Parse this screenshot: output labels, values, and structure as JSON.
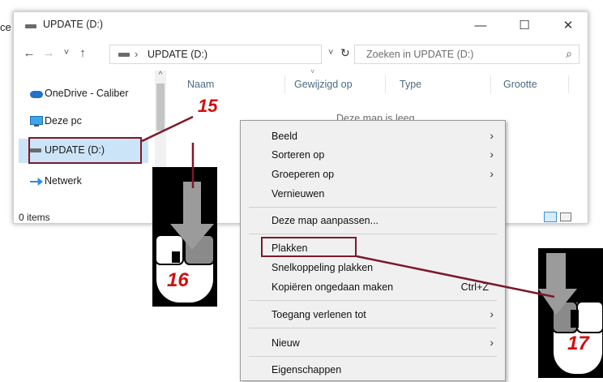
{
  "page_fragment": "ce",
  "window": {
    "title": "UPDATE (D:)",
    "min_glyph": "—",
    "max_glyph": "☐",
    "close_glyph": "✕"
  },
  "address": {
    "back_glyph": "←",
    "forward_glyph": "→",
    "recent_glyph": "˅",
    "up_glyph": "↑",
    "separator": "›",
    "path": "UPDATE (D:)",
    "dropdown_glyph": "˅",
    "refresh_glyph": "↻",
    "search_placeholder": "Zoeken in UPDATE (D:)",
    "search_glyph": "⌕"
  },
  "nav": {
    "items": [
      {
        "label": "OneDrive - Caliber"
      },
      {
        "label": "Deze pc"
      },
      {
        "label": "UPDATE (D:)"
      },
      {
        "label": "Netwerk"
      }
    ],
    "scroll_up_glyph": "^"
  },
  "status": {
    "items_text": "0 items"
  },
  "columns": [
    "Naam",
    "Gewijzigd op",
    "Type",
    "Grootte"
  ],
  "sort_glyph": "˅",
  "empty_text": "Deze map is leeg.",
  "context_menu": {
    "groups": [
      [
        {
          "label": "Beeld",
          "submenu": true
        },
        {
          "label": "Sorteren op",
          "submenu": true
        },
        {
          "label": "Groeperen op",
          "submenu": true
        },
        {
          "label": "Vernieuwen",
          "submenu": false
        }
      ],
      [
        {
          "label": "Deze map aanpassen...",
          "submenu": false
        }
      ],
      [
        {
          "label": "Plakken",
          "submenu": false
        },
        {
          "label": "Snelkoppeling plakken",
          "submenu": false
        },
        {
          "label": "Kopiëren ongedaan maken",
          "submenu": false,
          "shortcut": "Ctrl+Z"
        }
      ],
      [
        {
          "label": "Toegang verlenen tot",
          "submenu": true
        }
      ],
      [
        {
          "label": "Nieuw",
          "submenu": true
        }
      ],
      [
        {
          "label": "Eigenschappen",
          "submenu": false
        }
      ]
    ],
    "submenu_glyph": "›"
  },
  "annotations": {
    "step_15": "15",
    "step_16": "16",
    "step_17": "17"
  },
  "colors": {
    "callout_red": "#d01010",
    "highlight_border": "#7b1a2a",
    "selection_bg": "#cce4f7",
    "menu_bg": "#f0f0f0"
  }
}
